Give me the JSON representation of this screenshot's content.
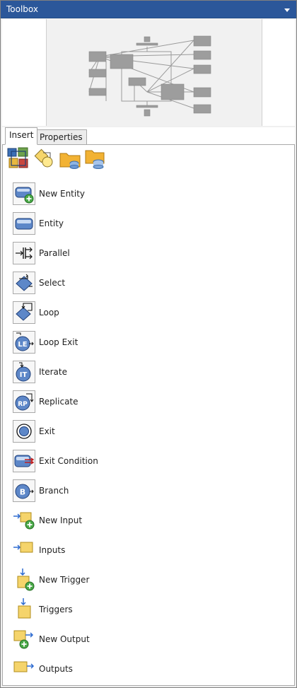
{
  "window": {
    "title": "Toolbox"
  },
  "tabs": [
    {
      "label": "Insert",
      "active": true
    },
    {
      "label": "Properties",
      "active": false
    }
  ],
  "toolbar": {
    "icons": [
      "entity-group-icon",
      "shape-connector-icon",
      "folder-database-icon",
      "database-folder-icon"
    ]
  },
  "items": [
    {
      "label": "New Entity",
      "icon": "new-entity-icon"
    },
    {
      "label": "Entity",
      "icon": "entity-icon"
    },
    {
      "label": "Parallel",
      "icon": "parallel-icon"
    },
    {
      "label": "Select",
      "icon": "select-icon"
    },
    {
      "label": "Loop",
      "icon": "loop-icon"
    },
    {
      "label": "Loop Exit",
      "icon": "loop-exit-icon",
      "badge": "LE"
    },
    {
      "label": "Iterate",
      "icon": "iterate-icon",
      "badge": "IT"
    },
    {
      "label": "Replicate",
      "icon": "replicate-icon",
      "badge": "RP"
    },
    {
      "label": "Exit",
      "icon": "exit-icon"
    },
    {
      "label": "Exit Condition",
      "icon": "exit-condition-icon"
    },
    {
      "label": "Branch",
      "icon": "branch-icon",
      "badge": "B"
    },
    {
      "label": "New Input",
      "icon": "new-input-icon"
    },
    {
      "label": "Inputs",
      "icon": "inputs-icon"
    },
    {
      "label": "New Trigger",
      "icon": "new-trigger-icon"
    },
    {
      "label": "Triggers",
      "icon": "triggers-icon"
    },
    {
      "label": "New Output",
      "icon": "new-output-icon"
    },
    {
      "label": "Outputs",
      "icon": "outputs-icon"
    }
  ],
  "colors": {
    "titlebar": "#2b579a",
    "entity_blue": "#4f78b9",
    "folder_yellow": "#f2c744",
    "add_green": "#3c9a3a",
    "arrow_blue": "#2e6bd1"
  }
}
